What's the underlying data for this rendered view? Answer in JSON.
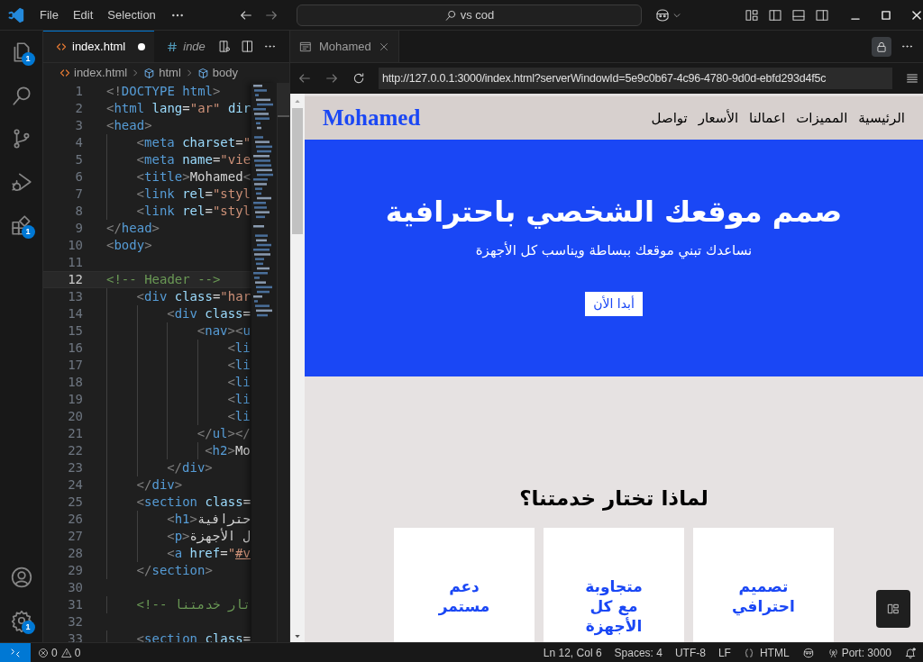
{
  "title_bar": {
    "menu": [
      "File",
      "Edit",
      "Selection"
    ],
    "search": "vs cod"
  },
  "activity_bar": {
    "top": [
      {
        "kind": "files",
        "badge": "1"
      },
      {
        "kind": "search"
      },
      {
        "kind": "branch"
      },
      {
        "kind": "debug"
      },
      {
        "kind": "blocks",
        "badge": "1"
      }
    ],
    "bottom": [
      {
        "kind": "account"
      },
      {
        "kind": "gear",
        "badge": "1"
      }
    ]
  },
  "editor": {
    "tabs": [
      {
        "kind": "html",
        "label": "index.html",
        "selected": true,
        "modified": true,
        "preview": false
      },
      {
        "kind": "css",
        "label": "inde",
        "selected": false,
        "modified": false,
        "preview": true
      }
    ],
    "breadcrumbs": [
      {
        "kind": "html",
        "label": "index.html"
      },
      {
        "kind": "element",
        "label": "html"
      },
      {
        "kind": "element",
        "label": "body"
      }
    ],
    "lines": [
      {
        "number": "1",
        "current": false,
        "tokens": [
          {
            "kind": "punct",
            "text": "<!"
          },
          {
            "kind": "tag",
            "text": "DOCTYPE html"
          },
          {
            "kind": "punct",
            "text": ">"
          }
        ]
      },
      {
        "number": "2",
        "current": false,
        "tokens": [
          {
            "kind": "punct",
            "text": "<"
          },
          {
            "kind": "tag",
            "text": "html"
          },
          {
            "kind": "attr",
            "text": " lang"
          },
          {
            "kind": "text",
            "text": "="
          },
          {
            "kind": "string",
            "text": "\"ar\""
          },
          {
            "kind": "attr",
            "text": " dir"
          }
        ]
      },
      {
        "number": "3",
        "current": false,
        "tokens": [
          {
            "kind": "punct",
            "text": "<"
          },
          {
            "kind": "tag",
            "text": "head"
          },
          {
            "kind": "punct",
            "text": ">"
          }
        ]
      },
      {
        "number": "4",
        "current": false,
        "tokens": [
          {
            "kind": "punct",
            "text": "    <"
          },
          {
            "kind": "tag",
            "text": "meta"
          },
          {
            "kind": "attr",
            "text": " charset"
          },
          {
            "kind": "text",
            "text": "="
          },
          {
            "kind": "string",
            "text": "\""
          }
        ]
      },
      {
        "number": "5",
        "current": false,
        "tokens": [
          {
            "kind": "punct",
            "text": "    <"
          },
          {
            "kind": "tag",
            "text": "meta"
          },
          {
            "kind": "attr",
            "text": " name"
          },
          {
            "kind": "text",
            "text": "="
          },
          {
            "kind": "string",
            "text": "\"vie"
          }
        ]
      },
      {
        "number": "6",
        "current": false,
        "tokens": [
          {
            "kind": "punct",
            "text": "    <"
          },
          {
            "kind": "tag",
            "text": "title"
          },
          {
            "kind": "punct",
            "text": ">"
          },
          {
            "kind": "text",
            "text": "Mohamed"
          },
          {
            "kind": "punct",
            "text": "<"
          }
        ]
      },
      {
        "number": "7",
        "current": false,
        "tokens": [
          {
            "kind": "punct",
            "text": "    <"
          },
          {
            "kind": "tag",
            "text": "link"
          },
          {
            "kind": "attr",
            "text": " rel"
          },
          {
            "kind": "text",
            "text": "="
          },
          {
            "kind": "string",
            "text": "\"styl"
          }
        ]
      },
      {
        "number": "8",
        "current": false,
        "tokens": [
          {
            "kind": "punct",
            "text": "    <"
          },
          {
            "kind": "tag",
            "text": "link"
          },
          {
            "kind": "attr",
            "text": " rel"
          },
          {
            "kind": "text",
            "text": "="
          },
          {
            "kind": "string",
            "text": "\"styl"
          }
        ]
      },
      {
        "number": "9",
        "current": false,
        "tokens": [
          {
            "kind": "punct",
            "text": "</"
          },
          {
            "kind": "tag",
            "text": "head"
          },
          {
            "kind": "punct",
            "text": ">"
          }
        ]
      },
      {
        "number": "10",
        "current": false,
        "tokens": [
          {
            "kind": "punct",
            "text": "<"
          },
          {
            "kind": "tag",
            "text": "body"
          },
          {
            "kind": "punct",
            "text": ">"
          }
        ]
      },
      {
        "number": "11",
        "current": false
      },
      {
        "number": "12",
        "current": true,
        "tokens": [
          {
            "kind": "comment",
            "text": "<!-- Header -->"
          }
        ]
      },
      {
        "number": "13",
        "current": false,
        "tokens": [
          {
            "kind": "punct",
            "text": "    <"
          },
          {
            "kind": "tag",
            "text": "div"
          },
          {
            "kind": "attr",
            "text": " class"
          },
          {
            "kind": "text",
            "text": "="
          },
          {
            "kind": "string",
            "text": "\"har"
          }
        ]
      },
      {
        "number": "14",
        "current": false,
        "tokens": [
          {
            "kind": "punct",
            "text": "        <"
          },
          {
            "kind": "tag",
            "text": "div"
          },
          {
            "kind": "attr",
            "text": " class"
          },
          {
            "kind": "text",
            "text": "="
          }
        ]
      },
      {
        "number": "15",
        "current": false,
        "tokens": [
          {
            "kind": "punct",
            "text": "            <"
          },
          {
            "kind": "tag",
            "text": "nav"
          },
          {
            "kind": "punct",
            "text": "><"
          },
          {
            "kind": "tag",
            "text": "u"
          }
        ]
      },
      {
        "number": "16",
        "current": false,
        "tokens": [
          {
            "kind": "punct",
            "text": "                <"
          },
          {
            "kind": "tag",
            "text": "li"
          }
        ]
      },
      {
        "number": "17",
        "current": false,
        "tokens": [
          {
            "kind": "punct",
            "text": "                <"
          },
          {
            "kind": "tag",
            "text": "li"
          }
        ]
      },
      {
        "number": "18",
        "current": false,
        "tokens": [
          {
            "kind": "punct",
            "text": "                <"
          },
          {
            "kind": "tag",
            "text": "li"
          }
        ]
      },
      {
        "number": "19",
        "current": false,
        "tokens": [
          {
            "kind": "punct",
            "text": "                <"
          },
          {
            "kind": "tag",
            "text": "li"
          }
        ]
      },
      {
        "number": "20",
        "current": false,
        "tokens": [
          {
            "kind": "punct",
            "text": "                <"
          },
          {
            "kind": "tag",
            "text": "li"
          }
        ]
      },
      {
        "number": "21",
        "current": false,
        "tokens": [
          {
            "kind": "punct",
            "text": "            </"
          },
          {
            "kind": "tag",
            "text": "ul"
          },
          {
            "kind": "punct",
            "text": "></"
          }
        ]
      },
      {
        "number": "22",
        "current": false,
        "tokens": [
          {
            "kind": "punct",
            "text": "             <"
          },
          {
            "kind": "tag",
            "text": "h2"
          },
          {
            "kind": "punct",
            "text": ">"
          },
          {
            "kind": "text",
            "text": "Mo"
          }
        ]
      },
      {
        "number": "23",
        "current": false,
        "tokens": [
          {
            "kind": "punct",
            "text": "        </"
          },
          {
            "kind": "tag",
            "text": "div"
          },
          {
            "kind": "punct",
            "text": ">"
          }
        ]
      },
      {
        "number": "24",
        "current": false,
        "tokens": [
          {
            "kind": "punct",
            "text": "    </"
          },
          {
            "kind": "tag",
            "text": "div"
          },
          {
            "kind": "punct",
            "text": ">"
          }
        ]
      },
      {
        "number": "25",
        "current": false,
        "tokens": [
          {
            "kind": "punct",
            "text": "    <"
          },
          {
            "kind": "tag",
            "text": "section"
          },
          {
            "kind": "attr",
            "text": " class"
          },
          {
            "kind": "text",
            "text": "="
          }
        ]
      },
      {
        "number": "26",
        "current": false,
        "tokens": [
          {
            "kind": "punct",
            "text": "        <"
          },
          {
            "kind": "tag",
            "text": "h1"
          },
          {
            "kind": "punct",
            "text": ">"
          },
          {
            "kind": "arabic",
            "text": "حترافية"
          }
        ]
      },
      {
        "number": "27",
        "current": false,
        "tokens": [
          {
            "kind": "punct",
            "text": "        <"
          },
          {
            "kind": "tag",
            "text": "p"
          },
          {
            "kind": "punct",
            "text": ">"
          },
          {
            "kind": "arabic",
            "text": "ل الأجهزة"
          }
        ]
      },
      {
        "number": "28",
        "current": false,
        "tokens": [
          {
            "kind": "punct",
            "text": "        <"
          },
          {
            "kind": "tag",
            "text": "a"
          },
          {
            "kind": "attr",
            "text": " href"
          },
          {
            "kind": "text",
            "text": "="
          },
          {
            "kind": "string",
            "text": "\""
          },
          {
            "kind": "link",
            "text": "#v"
          }
        ]
      },
      {
        "number": "29",
        "current": false,
        "tokens": [
          {
            "kind": "punct",
            "text": "    </"
          },
          {
            "kind": "tag",
            "text": "section"
          },
          {
            "kind": "punct",
            "text": ">"
          }
        ]
      },
      {
        "number": "30",
        "current": false
      },
      {
        "number": "31",
        "current": false,
        "tokens": [
          {
            "kind": "comment",
            "text": "    <!-- تار خدمتنا"
          }
        ]
      },
      {
        "number": "32",
        "current": false
      },
      {
        "number": "33",
        "current": false,
        "tokens": [
          {
            "kind": "punct",
            "text": "    <"
          },
          {
            "kind": "tag",
            "text": "section"
          },
          {
            "kind": "attr",
            "text": " class"
          },
          {
            "kind": "text",
            "text": "="
          }
        ]
      }
    ]
  },
  "browser": {
    "tab": "Mohamed",
    "url": "http://127.0.0.1:3000/index.html?serverWindowId=5e9c0b67-4c96-4780-9d0d-ebfd293d4f5c",
    "page": {
      "logo": "Mohamed",
      "nav": [
        "الرئيسية",
        "المميزات",
        "اعمالنا",
        "الأسعار",
        "تواصل"
      ],
      "hero": {
        "title": "صمم موقعك الشخصي باحترافية",
        "subtitle": "نساعدك تبني موقعك ببساطة ويناسب كل الأجهزة",
        "button": "أبدا الأن"
      },
      "features": {
        "title": "لماذا تختار خدمتنا؟",
        "cards": [
          "تصميم احترافي",
          "متجاوبة مع كل الأجهزة",
          "دعم مستمر"
        ]
      }
    }
  },
  "status_bar": {
    "errors": "0",
    "warnings": "0",
    "right": [
      {
        "kind": "text",
        "label": "Ln 12, Col 6"
      },
      {
        "kind": "text",
        "label": "Spaces: 4"
      },
      {
        "kind": "text",
        "label": "UTF-8"
      },
      {
        "kind": "text",
        "label": "LF"
      },
      {
        "kind": "language",
        "label": "HTML"
      },
      {
        "kind": "copilot"
      },
      {
        "kind": "port",
        "label": "Port: 3000"
      },
      {
        "kind": "bell"
      }
    ]
  }
}
